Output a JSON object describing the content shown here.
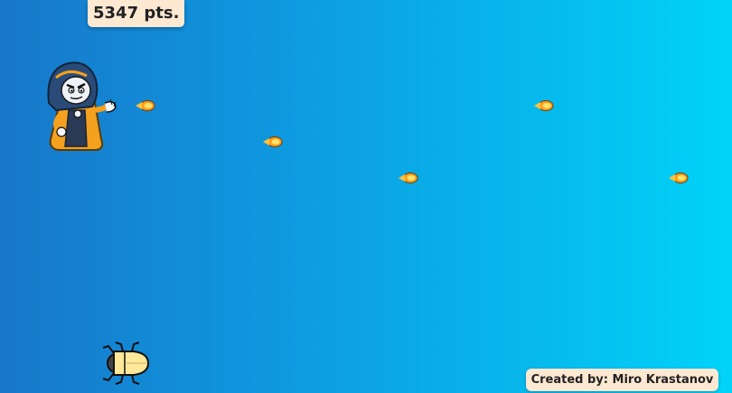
{
  "hud": {
    "score_label": "5347 pts."
  },
  "footer": {
    "credit_label": "Created by: Miro Krastanov"
  },
  "sprites": {
    "player": "wizard-character",
    "projectiles": "fireball",
    "enemy": "beetle-bug"
  },
  "colors": {
    "background_left": "#1877c9",
    "background_right": "#00d3f9",
    "hud_panel": "#fde8d2",
    "robe": "#f3a11f",
    "hood": "#2a4b78"
  }
}
